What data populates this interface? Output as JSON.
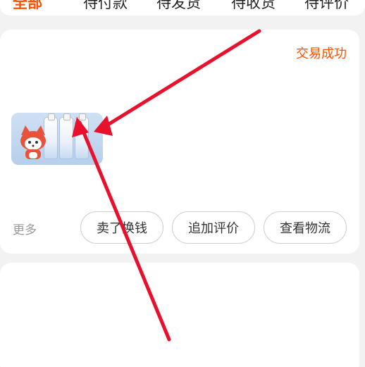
{
  "tabs": [
    "全部",
    "待付款",
    "待发货",
    "待收货",
    "待评价"
  ],
  "order": {
    "status": "交易成功",
    "more_label": "更多",
    "actions": [
      "卖了换钱",
      "追加评价",
      "查看物流"
    ]
  },
  "colors": {
    "accent": "#ff5000",
    "annotation_arrow": "#e8112d"
  },
  "icons": [
    "annotation-arrow"
  ]
}
